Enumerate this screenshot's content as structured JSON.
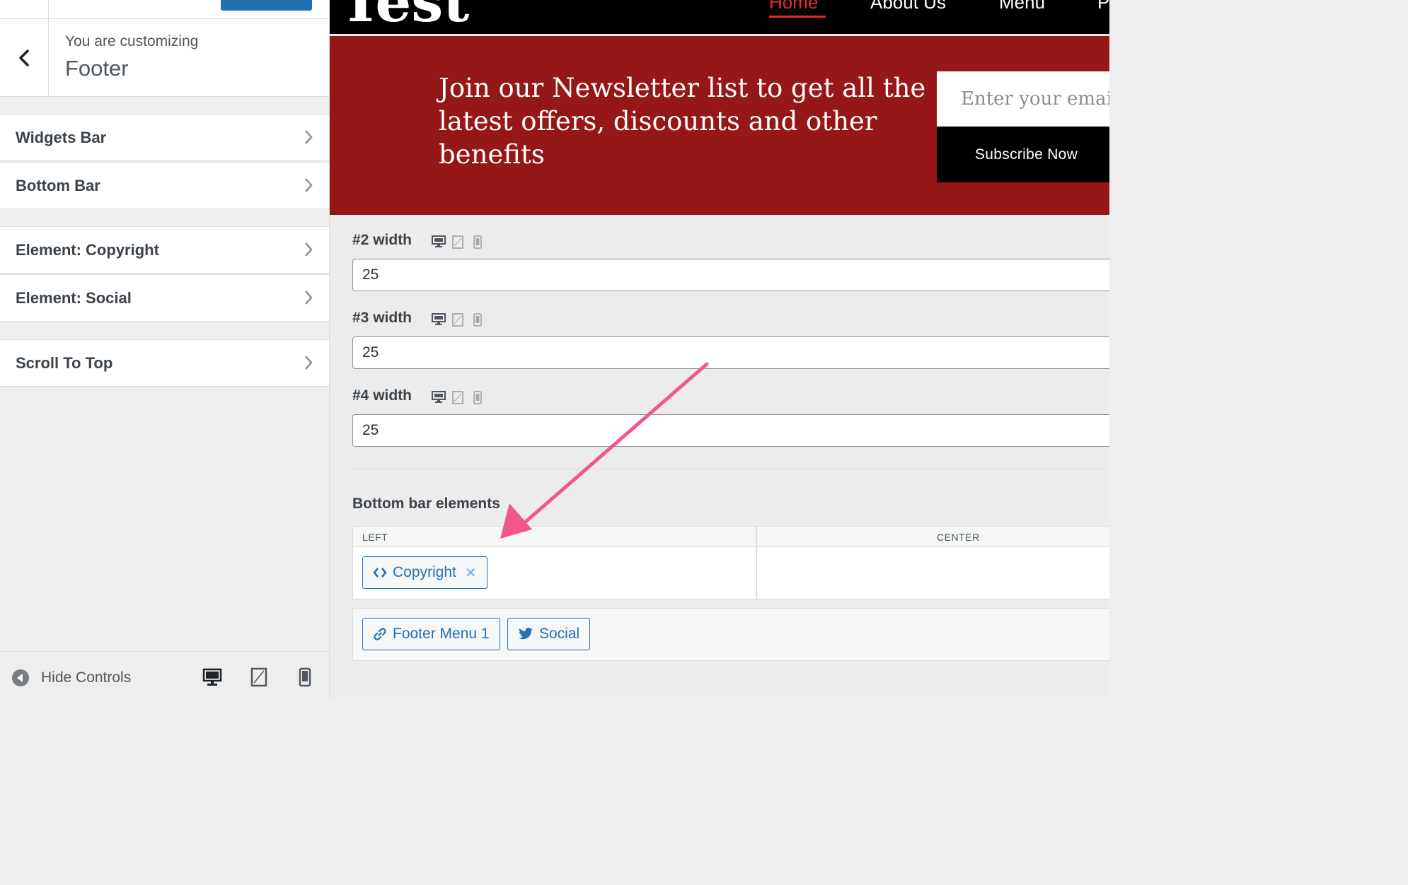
{
  "panel": {
    "customizing_label": "You are customizing",
    "section_title": "Footer",
    "items": [
      {
        "label": "Widgets Bar"
      },
      {
        "label": "Bottom Bar"
      },
      {
        "label": "Element: Copyright"
      },
      {
        "label": "Element: Social"
      },
      {
        "label": "Scroll To Top"
      }
    ],
    "hide_controls_label": "Hide Controls"
  },
  "site": {
    "logo": "Test",
    "nav": [
      {
        "label": "Home"
      },
      {
        "label": "About Us"
      },
      {
        "label": "Menu"
      },
      {
        "label": "P"
      }
    ],
    "newsletter_text": "Join our Newsletter list to get all the latest offers, discounts and other benefits",
    "email_placeholder": "Enter your email address",
    "subscribe_label": "Subscribe Now"
  },
  "settings": {
    "widths": [
      {
        "label": "#2 width",
        "value": "25"
      },
      {
        "label": "#3 width",
        "value": "25"
      },
      {
        "label": "#4 width",
        "value": "25"
      }
    ],
    "bottom_bar_title": "Bottom bar elements",
    "columns": [
      {
        "label": "LEFT"
      },
      {
        "label": "CENTER"
      }
    ],
    "left_elements": [
      {
        "label": "Copyright",
        "icon": "code-icon"
      }
    ],
    "available_elements": [
      {
        "label": "Footer Menu 1",
        "icon": "link-icon"
      },
      {
        "label": "Social",
        "icon": "twitter-icon"
      }
    ]
  },
  "colors": {
    "accent": "#2271b1",
    "header_bg": "#000000",
    "newsletter_bg": "#951717",
    "nav_active": "#e52a2a",
    "annotation_arrow": "#f0588a"
  }
}
